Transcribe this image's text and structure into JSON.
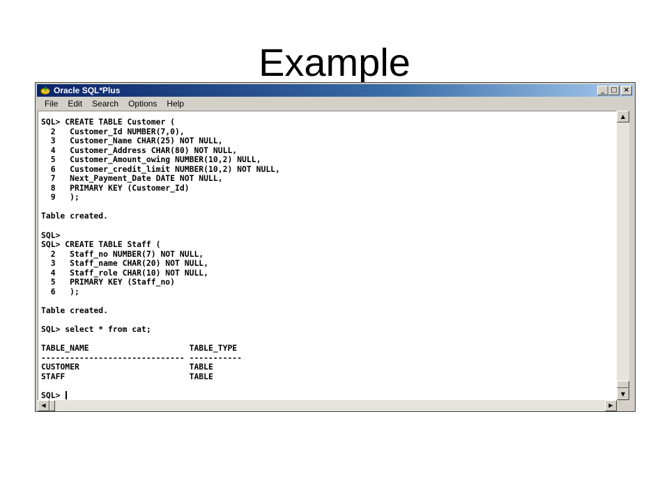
{
  "slide": {
    "title": "Example"
  },
  "window": {
    "title": "Oracle SQL*Plus",
    "icon": "oracle-sqlplus-icon",
    "controls": {
      "minimize": "_",
      "maximize": "□",
      "close": "×"
    }
  },
  "menu": {
    "items": [
      {
        "label": "File"
      },
      {
        "label": "Edit"
      },
      {
        "label": "Search"
      },
      {
        "label": "Options"
      },
      {
        "label": "Help"
      }
    ]
  },
  "console": {
    "lines": [
      "SQL> CREATE TABLE Customer (",
      "  2   Customer_Id NUMBER(7,0),",
      "  3   Customer_Name CHAR(25) NOT NULL,",
      "  4   Customer_Address CHAR(80) NOT NULL,",
      "  5   Customer_Amount_owing NUMBER(10,2) NULL,",
      "  6   Customer_credit_limit NUMBER(10,2) NOT NULL,",
      "  7   Next_Payment_Date DATE NOT NULL,",
      "  8   PRIMARY KEY (Customer_Id)",
      "  9   );",
      "",
      "Table created.",
      "",
      "SQL>",
      "SQL> CREATE TABLE Staff (",
      "  2   Staff_no NUMBER(7) NOT NULL,",
      "  3   Staff_name CHAR(20) NOT NULL,",
      "  4   Staff_role CHAR(10) NOT NULL,",
      "  5   PRIMARY KEY (Staff_no)",
      "  6   );",
      "",
      "Table created.",
      "",
      "SQL> select * from cat;",
      "",
      "TABLE_NAME                     TABLE_TYPE",
      "------------------------------ -----------",
      "CUSTOMER                       TABLE",
      "STAFF                          TABLE",
      "",
      "SQL> "
    ]
  },
  "scrollbars": {
    "up_arrow": "▲",
    "down_arrow": "▼",
    "left_arrow": "◀",
    "right_arrow": "▶"
  }
}
